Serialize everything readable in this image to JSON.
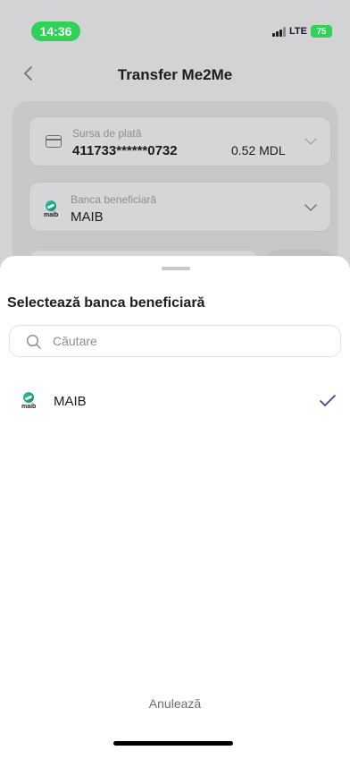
{
  "status_bar": {
    "time": "14:36",
    "network": "LTE",
    "battery": "75"
  },
  "nav": {
    "title": "Transfer Me2Me"
  },
  "form": {
    "source": {
      "label": "Sursa de plată",
      "card_number": "411733******0732",
      "balance": "0.52 MDL"
    },
    "bank": {
      "label": "Banca beneficiară",
      "value": "MAIB",
      "logo_text": "maib"
    }
  },
  "sheet": {
    "title": "Selectează banca beneficiară",
    "search": {
      "placeholder": "Căutare",
      "value": ""
    },
    "banks": [
      {
        "name": "MAIB",
        "logo_text": "maib",
        "selected": true
      }
    ],
    "cancel_label": "Anulează"
  },
  "colors": {
    "accent": "#2f3f9e",
    "time_pill": "#2fd158",
    "maib_green": "#1aa17e"
  }
}
